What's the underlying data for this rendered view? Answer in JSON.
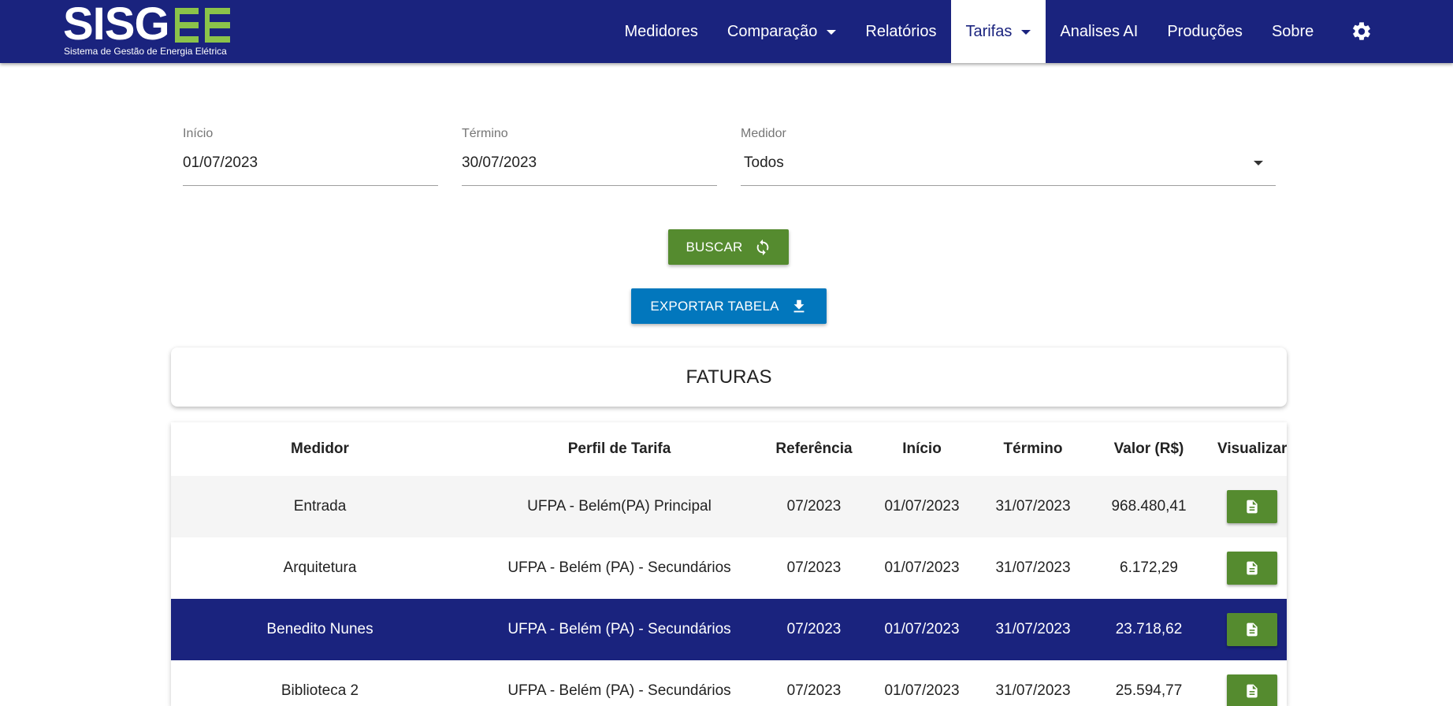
{
  "brand": {
    "logo_text": "SISG",
    "subtitle": "Sistema de Gestão de Energia Elétrica",
    "logo_bar_color": "#8bc34a"
  },
  "nav": {
    "items": [
      {
        "label": "Medidores",
        "has_dropdown": false,
        "active": false
      },
      {
        "label": "Comparação",
        "has_dropdown": true,
        "active": false
      },
      {
        "label": "Relatórios",
        "has_dropdown": false,
        "active": false
      },
      {
        "label": "Tarifas",
        "has_dropdown": true,
        "active": true
      },
      {
        "label": "Analises AI",
        "has_dropdown": false,
        "active": false
      },
      {
        "label": "Produções",
        "has_dropdown": false,
        "active": false
      },
      {
        "label": "Sobre",
        "has_dropdown": false,
        "active": false
      }
    ],
    "settings_icon": "gear-icon"
  },
  "filters": {
    "start": {
      "label": "Início",
      "value": "01/07/2023"
    },
    "end": {
      "label": "Término",
      "value": "30/07/2023"
    },
    "meter": {
      "label": "Medidor",
      "value": "Todos"
    }
  },
  "actions": {
    "search_label": "BUSCAR",
    "search_icon": "refresh-icon",
    "export_label": "EXPORTAR TABELA",
    "export_icon": "download-icon"
  },
  "card": {
    "title": "FATURAS"
  },
  "table": {
    "columns": [
      "Medidor",
      "Perfil de Tarifa",
      "Referência",
      "Início",
      "Término",
      "Valor (R$)",
      "Visualizar"
    ],
    "rows": [
      [
        "Entrada",
        "UFPA - Belém(PA) Principal",
        "07/2023",
        "01/07/2023",
        "31/07/2023",
        "968.480,41"
      ],
      [
        "Arquitetura",
        "UFPA - Belém (PA) - Secundários",
        "07/2023",
        "01/07/2023",
        "31/07/2023",
        "6.172,29"
      ],
      [
        "Benedito Nunes",
        "UFPA - Belém (PA) - Secundários",
        "07/2023",
        "01/07/2023",
        "31/07/2023",
        "23.718,62"
      ],
      [
        "Biblioteca 2",
        "UFPA - Belém (PA) - Secundários",
        "07/2023",
        "01/07/2023",
        "31/07/2023",
        "25.594,77"
      ]
    ],
    "selected_row": 2,
    "view_icon": "document-icon"
  },
  "colors": {
    "primary": "#1a237e",
    "success": "#558b2f",
    "export": "#0277bd"
  }
}
